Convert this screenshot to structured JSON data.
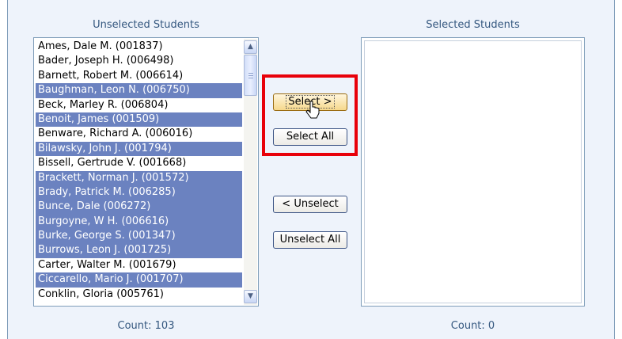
{
  "unselected": {
    "title": "Unselected Students",
    "count_label": "Count: 103",
    "items": [
      {
        "name": "Ames, Dale M. (001837)",
        "selected": false
      },
      {
        "name": "Bader, Joseph H. (006498)",
        "selected": false
      },
      {
        "name": "Barnett, Robert M. (006614)",
        "selected": false
      },
      {
        "name": "Baughman, Leon N. (006750)",
        "selected": true
      },
      {
        "name": "Beck, Marley R. (006804)",
        "selected": false
      },
      {
        "name": "Benoit, James (001509)",
        "selected": true
      },
      {
        "name": "Benware, Richard A. (006016)",
        "selected": false
      },
      {
        "name": "Bilawsky, John J. (001794)",
        "selected": true
      },
      {
        "name": "Bissell, Gertrude V. (001668)",
        "selected": false
      },
      {
        "name": "Brackett, Norman J. (001572)",
        "selected": true
      },
      {
        "name": "Brady, Patrick M. (006285)",
        "selected": true
      },
      {
        "name": "Bunce, Dale (006272)",
        "selected": true
      },
      {
        "name": "Burgoyne, W H. (006616)",
        "selected": true
      },
      {
        "name": "Burke, George S. (001347)",
        "selected": true
      },
      {
        "name": "Burrows, Leon J. (001725)",
        "selected": true
      },
      {
        "name": "Carter, Walter M. (001679)",
        "selected": false
      },
      {
        "name": "Ciccarello, Mario J. (001707)",
        "selected": true
      },
      {
        "name": "Conklin, Gloria (005761)",
        "selected": false
      }
    ]
  },
  "selected": {
    "title": "Selected Students",
    "count_label": "Count: 0"
  },
  "buttons": {
    "select": "Select >",
    "select_all": "Select All",
    "unselect": "< Unselect",
    "unselect_all": "Unselect All"
  },
  "icons": {
    "scroll_up": "chevron-up-icon",
    "scroll_down": "chevron-down-icon",
    "cursor": "hand-pointer-icon"
  },
  "colors": {
    "selection": "#6b82c0",
    "highlight": "#e8000a",
    "label": "#34577f"
  }
}
